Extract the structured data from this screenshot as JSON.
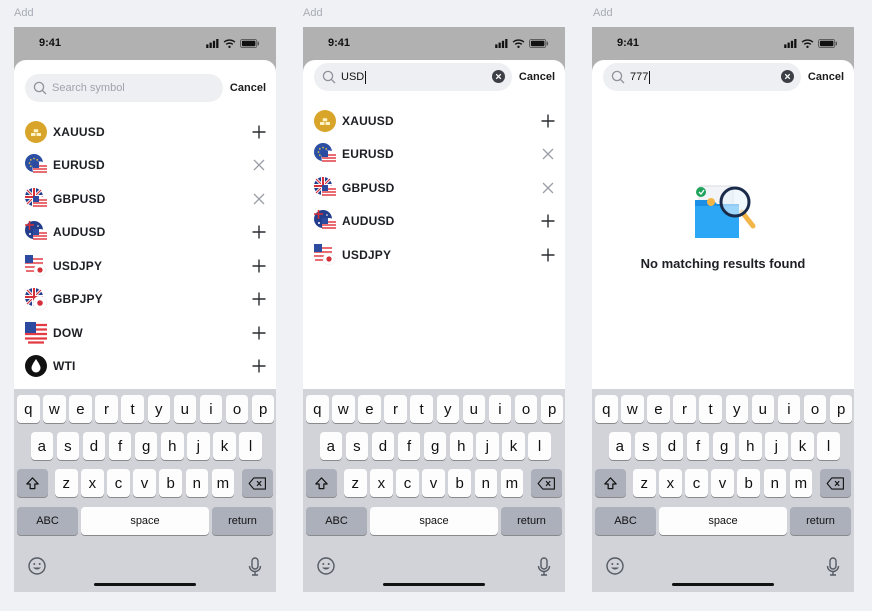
{
  "frames": [
    {
      "label": "Add",
      "status_time": "9:41",
      "search": {
        "value": "",
        "placeholder": "Search symbol",
        "has_clear": false
      },
      "cancel_label": "Cancel",
      "items": [
        {
          "symbol": "XAUUSD",
          "flag": "gold-icon",
          "action": "plus-icon"
        },
        {
          "symbol": "EURUSD",
          "flag": "eu-us-flag-icon",
          "action": "close-icon"
        },
        {
          "symbol": "GBPUSD",
          "flag": "gb-us-flag-icon",
          "action": "close-icon"
        },
        {
          "symbol": "AUDUSD",
          "flag": "au-us-flag-icon",
          "action": "plus-icon"
        },
        {
          "symbol": "USDJPY",
          "flag": "us-jp-flag-icon",
          "action": "plus-icon"
        },
        {
          "symbol": "GBPJPY",
          "flag": "gb-jp-flag-icon",
          "action": "plus-icon"
        },
        {
          "symbol": "DOW",
          "flag": "us-flag-icon",
          "action": "plus-icon"
        },
        {
          "symbol": "WTI",
          "flag": "oil-drop-icon",
          "action": "plus-icon"
        }
      ],
      "empty_message": ""
    },
    {
      "label": "Add",
      "status_time": "9:41",
      "search": {
        "value": "USD",
        "placeholder": "",
        "has_clear": true
      },
      "cancel_label": "Cancel",
      "items": [
        {
          "symbol": "XAUUSD",
          "flag": "gold-icon",
          "action": "plus-icon"
        },
        {
          "symbol": "EURUSD",
          "flag": "eu-us-flag-icon",
          "action": "close-icon"
        },
        {
          "symbol": "GBPUSD",
          "flag": "gb-us-flag-icon",
          "action": "close-icon"
        },
        {
          "symbol": "AUDUSD",
          "flag": "au-us-flag-icon",
          "action": "plus-icon"
        },
        {
          "symbol": "USDJPY",
          "flag": "us-jp-flag-icon",
          "action": "plus-icon"
        }
      ],
      "empty_message": ""
    },
    {
      "label": "Add",
      "status_time": "9:41",
      "search": {
        "value": "777",
        "placeholder": "",
        "has_clear": true
      },
      "cancel_label": "Cancel",
      "items": [],
      "empty_message": "No matching results found"
    }
  ],
  "keyboard": {
    "row1": [
      "q",
      "w",
      "e",
      "r",
      "t",
      "y",
      "u",
      "i",
      "o",
      "p"
    ],
    "row2": [
      "a",
      "s",
      "d",
      "f",
      "g",
      "h",
      "j",
      "k",
      "l"
    ],
    "row3": [
      "z",
      "x",
      "c",
      "v",
      "b",
      "n",
      "m"
    ],
    "abc_label": "ABC",
    "space_label": "space",
    "return_label": "return",
    "icons": [
      "shift-icon",
      "backspace-icon",
      "emoji-icon",
      "microphone-icon"
    ]
  },
  "colors": {
    "background": "#f0f1f5",
    "status_bar": "#b1b1b1",
    "keyboard": "#d1d3d9",
    "key": "#fdfdfe",
    "key_dark": "#abb0bb",
    "search_field": "#eeeff2",
    "text": "#1d1f24"
  }
}
